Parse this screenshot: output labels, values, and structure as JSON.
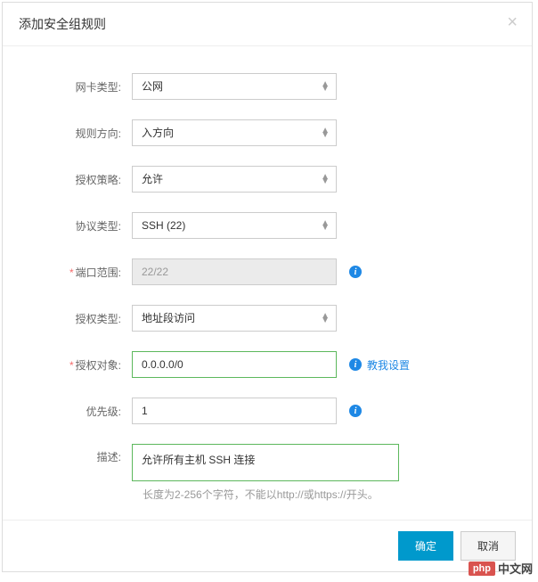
{
  "modal": {
    "title": "添加安全组规则"
  },
  "form": {
    "nicType": {
      "label": "网卡类型:",
      "value": "公网"
    },
    "direction": {
      "label": "规则方向:",
      "value": "入方向"
    },
    "policy": {
      "label": "授权策略:",
      "value": "允许"
    },
    "protocol": {
      "label": "协议类型:",
      "value": "SSH (22)"
    },
    "portRange": {
      "label": "端口范围:",
      "value": "22/22"
    },
    "authType": {
      "label": "授权类型:",
      "value": "地址段访问"
    },
    "authObject": {
      "label": "授权对象:",
      "value": "0.0.0.0/0",
      "helpLink": "教我设置"
    },
    "priority": {
      "label": "优先级:",
      "value": "1"
    },
    "description": {
      "label": "描述:",
      "value": "允许所有主机 SSH 连接",
      "hint": "长度为2-256个字符，不能以http://或https://开头。"
    }
  },
  "footer": {
    "confirm": "确定",
    "cancel": "取消"
  },
  "watermark": {
    "badge": "php",
    "text": "中文网"
  }
}
